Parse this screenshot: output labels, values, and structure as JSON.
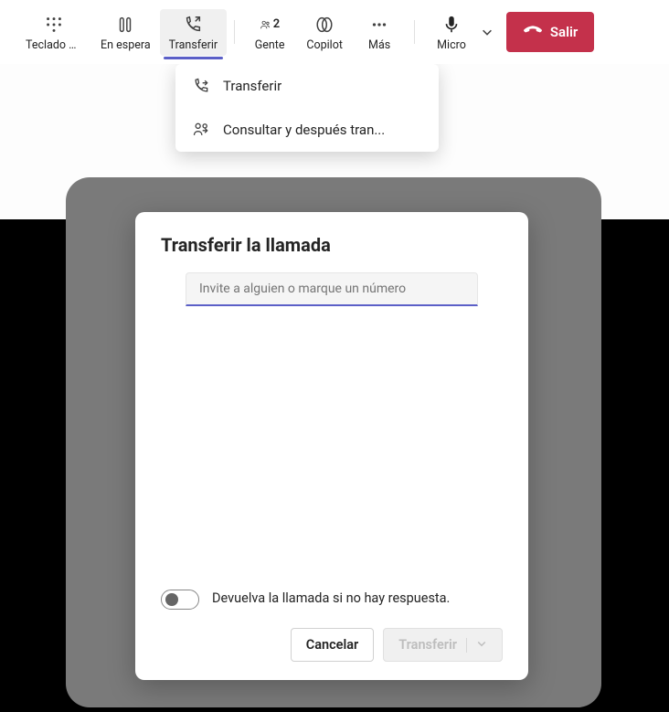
{
  "toolbar": {
    "keypad_label": "Teclado de ...",
    "hold_label": "En espera",
    "transfer_label": "Transferir",
    "people_label": "Gente",
    "people_count": "2",
    "copilot_label": "Copilot",
    "more_label": "Más",
    "mic_label": "Micro",
    "leave_label": "Salir"
  },
  "dropdown": {
    "item1": "Transferir",
    "item2": "Consultar y después tran..."
  },
  "dialog": {
    "title": "Transferir la llamada",
    "invite_placeholder": "Invite a alguien o marque un número",
    "ringback_label": "Devuelva la llamada si no hay respuesta.",
    "cancel_label": "Cancelar",
    "transfer_label": "Transferir"
  }
}
